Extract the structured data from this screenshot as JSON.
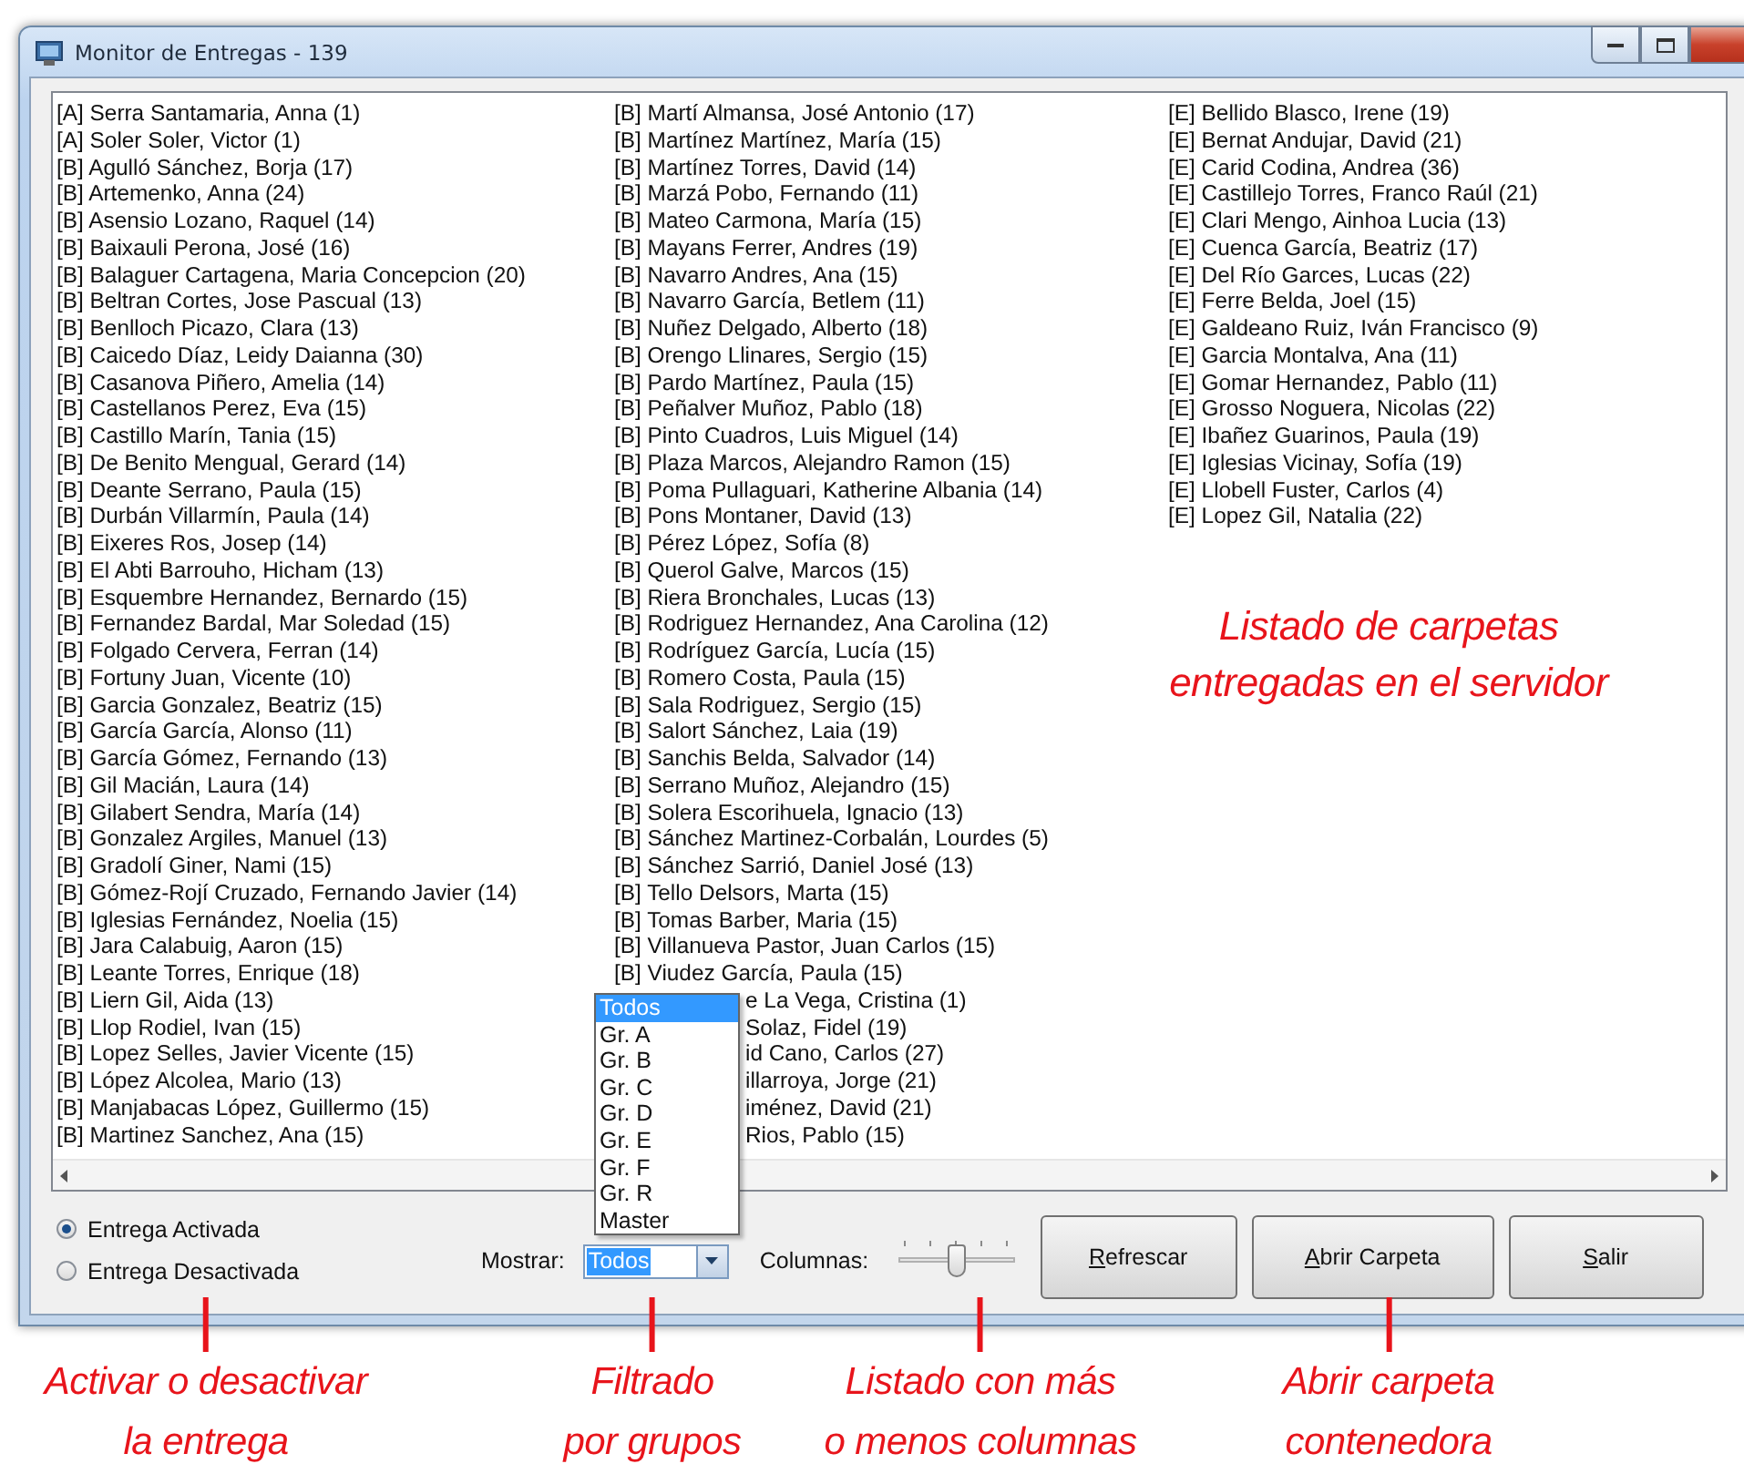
{
  "window": {
    "title": "Monitor de Entregas - 139"
  },
  "list": {
    "items": [
      {
        "kind": "full",
        "text": "[A] Serra Santamaria, Anna (1)"
      },
      {
        "kind": "full",
        "text": "[A] Soler Soler, Victor (1)"
      },
      {
        "kind": "full",
        "text": "[B] Agulló Sánchez, Borja (17)"
      },
      {
        "kind": "full",
        "text": "[B] Artemenko, Anna (24)"
      },
      {
        "kind": "full",
        "text": "[B] Asensio Lozano, Raquel (14)"
      },
      {
        "kind": "full",
        "text": "[B] Baixauli Perona, José (16)"
      },
      {
        "kind": "full",
        "text": "[B] Balaguer Cartagena, Maria Concepcion (20)"
      },
      {
        "kind": "full",
        "text": "[B] Beltran Cortes, Jose Pascual (13)"
      },
      {
        "kind": "full",
        "text": "[B] Benlloch Picazo, Clara (13)"
      },
      {
        "kind": "full",
        "text": "[B] Caicedo Díaz, Leidy Daianna (30)"
      },
      {
        "kind": "full",
        "text": "[B] Casanova Piñero, Amelia (14)"
      },
      {
        "kind": "full",
        "text": "[B] Castellanos Perez, Eva (15)"
      },
      {
        "kind": "full",
        "text": "[B] Castillo Marín, Tania (15)"
      },
      {
        "kind": "full",
        "text": "[B] De Benito Mengual, Gerard (14)"
      },
      {
        "kind": "full",
        "text": "[B] Deante Serrano, Paula (15)"
      },
      {
        "kind": "full",
        "text": "[B] Durbán Villarmín, Paula (14)"
      },
      {
        "kind": "full",
        "text": "[B] Eixeres Ros, Josep (14)"
      },
      {
        "kind": "full",
        "text": "[B] El Abti Barrouho, Hicham (13)"
      },
      {
        "kind": "full",
        "text": "[B] Esquembre Hernandez, Bernardo (15)"
      },
      {
        "kind": "full",
        "text": "[B] Fernandez Bardal, Mar Soledad (15)"
      },
      {
        "kind": "full",
        "text": "[B] Folgado Cervera, Ferran (14)"
      },
      {
        "kind": "full",
        "text": "[B] Fortuny Juan, Vicente (10)"
      },
      {
        "kind": "full",
        "text": "[B] Garcia Gonzalez, Beatriz (15)"
      },
      {
        "kind": "full",
        "text": "[B] García García, Alonso (11)"
      },
      {
        "kind": "full",
        "text": "[B] García Gómez, Fernando (13)"
      },
      {
        "kind": "full",
        "text": "[B] Gil Macián, Laura (14)"
      },
      {
        "kind": "full",
        "text": "[B] Gilabert Sendra, María (14)"
      },
      {
        "kind": "full",
        "text": "[B] Gonzalez Argiles, Manuel (13)"
      },
      {
        "kind": "full",
        "text": "[B] Gradolí Giner, Nami (15)"
      },
      {
        "kind": "full",
        "text": "[B] Gómez-Rojí Cruzado, Fernando Javier (14)"
      },
      {
        "kind": "full",
        "text": "[B] Iglesias Fernández, Noelia (15)"
      },
      {
        "kind": "full",
        "text": "[B] Jara Calabuig, Aaron (15)"
      },
      {
        "kind": "full",
        "text": "[B] Leante Torres, Enrique (18)"
      },
      {
        "kind": "full",
        "text": "[B] Liern Gil, Aida (13)"
      },
      {
        "kind": "full",
        "text": "[B] Llop Rodiel, Ivan (15)"
      },
      {
        "kind": "full",
        "text": "[B] Lopez Selles, Javier Vicente (15)"
      },
      {
        "kind": "full",
        "text": "[B] López Alcolea, Mario (13)"
      },
      {
        "kind": "full",
        "text": "[B] Manjabacas López, Guillermo (15)"
      },
      {
        "kind": "full",
        "text": "[B] Martinez Sanchez, Ana (15)"
      },
      {
        "kind": "full",
        "text": "[B] Martí Almansa, José Antonio (17)"
      },
      {
        "kind": "full",
        "text": "[B] Martínez Martínez, María (15)"
      },
      {
        "kind": "full",
        "text": "[B] Martínez Torres, David (14)"
      },
      {
        "kind": "full",
        "text": "[B] Marzá Pobo, Fernando (11)"
      },
      {
        "kind": "full",
        "text": "[B] Mateo Carmona, María (15)"
      },
      {
        "kind": "full",
        "text": "[B] Mayans Ferrer, Andres (19)"
      },
      {
        "kind": "full",
        "text": "[B] Navarro Andres, Ana (15)"
      },
      {
        "kind": "full",
        "text": "[B] Navarro García, Betlem (11)"
      },
      {
        "kind": "full",
        "text": "[B] Nuñez Delgado, Alberto (18)"
      },
      {
        "kind": "full",
        "text": "[B] Orengo Llinares, Sergio (15)"
      },
      {
        "kind": "full",
        "text": "[B] Pardo Martínez, Paula (15)"
      },
      {
        "kind": "full",
        "text": "[B] Peñalver Muñoz, Pablo (18)"
      },
      {
        "kind": "full",
        "text": "[B] Pinto Cuadros, Luis Miguel (14)"
      },
      {
        "kind": "full",
        "text": "[B] Plaza Marcos, Alejandro Ramon (15)"
      },
      {
        "kind": "full",
        "text": "[B] Poma Pullaguari, Katherine Albania (14)"
      },
      {
        "kind": "full",
        "text": "[B] Pons Montaner, David (13)"
      },
      {
        "kind": "full",
        "text": "[B] Pérez López, Sofía (8)"
      },
      {
        "kind": "full",
        "text": "[B] Querol Galve, Marcos (15)"
      },
      {
        "kind": "full",
        "text": "[B] Riera Bronchales, Lucas (13)"
      },
      {
        "kind": "full",
        "text": "[B] Rodriguez Hernandez, Ana Carolina (12)"
      },
      {
        "kind": "full",
        "text": "[B] Rodríguez García, Lucía (15)"
      },
      {
        "kind": "full",
        "text": "[B] Romero Costa, Paula (15)"
      },
      {
        "kind": "full",
        "text": "[B] Sala Rodriguez, Sergio (15)"
      },
      {
        "kind": "full",
        "text": "[B] Salort Sánchez, Laia (19)"
      },
      {
        "kind": "full",
        "text": "[B] Sanchis Belda, Salvador (14)"
      },
      {
        "kind": "full",
        "text": "[B] Serrano Muñoz, Alejandro (15)"
      },
      {
        "kind": "full",
        "text": "[B] Solera Escorihuela, Ignacio (13)"
      },
      {
        "kind": "full",
        "text": "[B] Sánchez Martinez-Corbalán, Lourdes (5)"
      },
      {
        "kind": "full",
        "text": "[B] Sánchez Sarrió, Daniel José (13)"
      },
      {
        "kind": "full",
        "text": "[B] Tello Delsors, Marta (15)"
      },
      {
        "kind": "full",
        "text": "[B] Tomas Barber, Maria (15)"
      },
      {
        "kind": "full",
        "text": "[B] Villanueva Pastor, Juan Carlos (15)"
      },
      {
        "kind": "full",
        "text": "[B] Viudez García, Paula (15)"
      },
      {
        "kind": "partial",
        "text": "e La Vega, Cristina (1)"
      },
      {
        "kind": "partial",
        "text": "Solaz, Fidel (19)"
      },
      {
        "kind": "partial",
        "text": "id Cano, Carlos (27)"
      },
      {
        "kind": "partial",
        "text": "illarroya, Jorge (21)"
      },
      {
        "kind": "partial",
        "text": "iménez, David (21)"
      },
      {
        "kind": "partial",
        "text": "Rios, Pablo (15)"
      },
      {
        "kind": "full",
        "text": "[E] Bellido Blasco, Irene (19)"
      },
      {
        "kind": "full",
        "text": "[E] Bernat Andujar, David (21)"
      },
      {
        "kind": "full",
        "text": "[E] Carid Codina, Andrea (36)"
      },
      {
        "kind": "full",
        "text": "[E] Castillejo Torres, Franco Raúl (21)"
      },
      {
        "kind": "full",
        "text": "[E] Clari Mengo, Ainhoa Lucia (13)"
      },
      {
        "kind": "full",
        "text": "[E] Cuenca García, Beatriz (17)"
      },
      {
        "kind": "full",
        "text": "[E] Del Río Garces, Lucas (22)"
      },
      {
        "kind": "full",
        "text": "[E] Ferre Belda, Joel (15)"
      },
      {
        "kind": "full",
        "text": "[E] Galdeano Ruiz, Iván Francisco (9)"
      },
      {
        "kind": "full",
        "text": "[E] Garcia Montalva, Ana (11)"
      },
      {
        "kind": "full",
        "text": "[E] Gomar Hernandez, Pablo (11)"
      },
      {
        "kind": "full",
        "text": "[E] Grosso Noguera, Nicolas (22)"
      },
      {
        "kind": "full",
        "text": "[E] Ibañez Guarinos, Paula (19)"
      },
      {
        "kind": "full",
        "text": "[E] Iglesias Vicinay, Sofía (19)"
      },
      {
        "kind": "full",
        "text": "[E] Llobell Fuster, Carlos (4)"
      },
      {
        "kind": "full",
        "text": "[E] Lopez Gil, Natalia (22)"
      }
    ]
  },
  "radios": [
    {
      "label": "Entrega Activada",
      "selected": true
    },
    {
      "label": "Entrega Desactivada",
      "selected": false
    }
  ],
  "filter": {
    "label": "Mostrar:",
    "value": "Todos",
    "options": [
      {
        "label": "Todos",
        "selected": true
      },
      {
        "label": "Gr. A",
        "selected": false
      },
      {
        "label": "Gr. B",
        "selected": false
      },
      {
        "label": "Gr. C",
        "selected": false
      },
      {
        "label": "Gr. D",
        "selected": false
      },
      {
        "label": "Gr. E",
        "selected": false
      },
      {
        "label": "Gr. F",
        "selected": false
      },
      {
        "label": "Gr. R",
        "selected": false
      },
      {
        "label": "Master",
        "selected": false
      }
    ]
  },
  "columns_slider": {
    "label": "Columnas:",
    "level": 0.5
  },
  "buttons": [
    {
      "label": "Refrescar"
    },
    {
      "label": "Abrir Carpeta"
    },
    {
      "label": "Salir"
    }
  ],
  "annotations": [
    {
      "lines": [
        "Listado de carpetas",
        "entregadas en el servidor"
      ]
    },
    {
      "lines": [
        "Activar o desactivar",
        "la entrega"
      ]
    },
    {
      "lines": [
        "Filtrado",
        "por grupos"
      ]
    },
    {
      "lines": [
        "Listado con más",
        "o menos columnas"
      ]
    },
    {
      "lines": [
        "Abrir carpeta",
        "contenedora"
      ]
    }
  ]
}
